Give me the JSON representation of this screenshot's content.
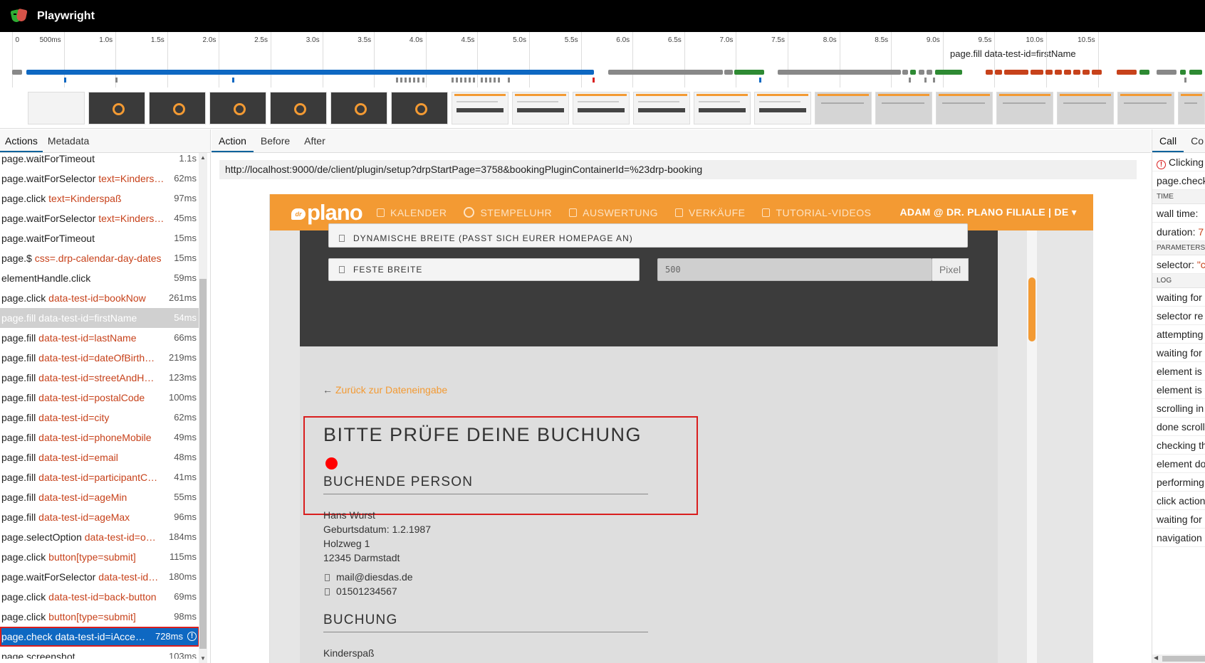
{
  "app": {
    "title": "Playwright"
  },
  "timeline": {
    "ticks": [
      "0",
      "500ms",
      "1.0s",
      "1.5s",
      "2.0s",
      "2.5s",
      "3.0s",
      "3.5s",
      "4.0s",
      "4.5s",
      "5.0s",
      "5.5s",
      "6.0s",
      "6.5s",
      "7.0s",
      "7.5s",
      "8.0s",
      "8.5s",
      "9.0s",
      "9.5s",
      "10.0s",
      "10.5s"
    ],
    "hover_label": "page.fill data-test-id=firstName"
  },
  "left_panel": {
    "tabs": [
      {
        "label": "Actions",
        "active": true
      },
      {
        "label": "Metadata",
        "active": false
      }
    ],
    "actions": [
      {
        "method": "page.waitForTimeout",
        "selector": "",
        "duration": "1.1s",
        "state": ""
      },
      {
        "method": "page.waitForSelector",
        "selector": "text=Kinders…",
        "duration": "62ms",
        "state": ""
      },
      {
        "method": "page.click",
        "selector": "text=Kinderspaß",
        "duration": "97ms",
        "state": ""
      },
      {
        "method": "page.waitForSelector",
        "selector": "text=Kinders…",
        "duration": "45ms",
        "state": ""
      },
      {
        "method": "page.waitForTimeout",
        "selector": "",
        "duration": "15ms",
        "state": ""
      },
      {
        "method": "page.$",
        "selector": "css=.drp-calendar-day-dates",
        "duration": "15ms",
        "state": ""
      },
      {
        "method": "elementHandle.click",
        "selector": "",
        "duration": "59ms",
        "state": ""
      },
      {
        "method": "page.click",
        "selector": "data-test-id=bookNow",
        "duration": "261ms",
        "state": ""
      },
      {
        "method": "page.fill",
        "selector": "data-test-id=firstName",
        "duration": "54ms",
        "state": "selected"
      },
      {
        "method": "page.fill",
        "selector": "data-test-id=lastName",
        "duration": "66ms",
        "state": ""
      },
      {
        "method": "page.fill",
        "selector": "data-test-id=dateOfBirth…",
        "duration": "219ms",
        "state": ""
      },
      {
        "method": "page.fill",
        "selector": "data-test-id=streetAndH…",
        "duration": "123ms",
        "state": ""
      },
      {
        "method": "page.fill",
        "selector": "data-test-id=postalCode",
        "duration": "100ms",
        "state": ""
      },
      {
        "method": "page.fill",
        "selector": "data-test-id=city",
        "duration": "62ms",
        "state": ""
      },
      {
        "method": "page.fill",
        "selector": "data-test-id=phoneMobile",
        "duration": "49ms",
        "state": ""
      },
      {
        "method": "page.fill",
        "selector": "data-test-id=email",
        "duration": "48ms",
        "state": ""
      },
      {
        "method": "page.fill",
        "selector": "data-test-id=participantC…",
        "duration": "41ms",
        "state": ""
      },
      {
        "method": "page.fill",
        "selector": "data-test-id=ageMin",
        "duration": "55ms",
        "state": ""
      },
      {
        "method": "page.fill",
        "selector": "data-test-id=ageMax",
        "duration": "96ms",
        "state": ""
      },
      {
        "method": "page.selectOption",
        "selector": "data-test-id=o…",
        "duration": "184ms",
        "state": ""
      },
      {
        "method": "page.click",
        "selector": "button[type=submit]",
        "duration": "115ms",
        "state": ""
      },
      {
        "method": "page.waitForSelector",
        "selector": "data-test-id…",
        "duration": "180ms",
        "state": ""
      },
      {
        "method": "page.click",
        "selector": "data-test-id=back-button",
        "duration": "69ms",
        "state": ""
      },
      {
        "method": "page.click",
        "selector": "button[type=submit]",
        "duration": "98ms",
        "state": ""
      },
      {
        "method": "page.check",
        "selector": "data-test-id=iAcce…",
        "duration": "728ms",
        "state": "active"
      },
      {
        "method": "page.screenshot",
        "selector": "",
        "duration": "103ms",
        "state": ""
      }
    ]
  },
  "middle_panel": {
    "tabs": [
      {
        "label": "Action",
        "active": true
      },
      {
        "label": "Before",
        "active": false
      },
      {
        "label": "After",
        "active": false
      }
    ],
    "url": "http://localhost:9000/de/client/plugin/setup?drpStartPage=3758&bookingPluginContainerId=%23drp-booking"
  },
  "snapshot": {
    "brand": {
      "prefix": "dr",
      "name": "plano"
    },
    "nav": [
      "KALENDER",
      "STEMPELUHR",
      "AUSWERTUNG",
      "VERKÄUFE",
      "TUTORIAL-VIDEOS"
    ],
    "user": "ADAM @ DR. PLANO FILIALE | DE ▾",
    "option_dynamic": "DYNAMISCHE BREITE (PASST SICH EURER HOMEPAGE AN)",
    "option_fixed": "FESTE BREITE",
    "width_value": "500",
    "width_unit": "Pixel",
    "back_link": "Zurück zur Dateneingabe",
    "heading": "BITTE PRÜFE DEINE BUCHUNG",
    "section_person": "BUCHENDE PERSON",
    "person": {
      "name": "Hans Wurst",
      "birth": "Geburtsdatum: 1.2.1987",
      "street": "Holzweg 1",
      "city": "12345 Darmstadt",
      "email": "mail@diesdas.de",
      "phone": "01501234567"
    },
    "section_booking": "BUCHUNG",
    "booking_item": "Kinderspaß",
    "colors": {
      "accent": "#f39a33",
      "highlight": "#d91e1e"
    }
  },
  "right_panel": {
    "tabs": [
      {
        "label": "Call",
        "active": true
      },
      {
        "label": "Co",
        "active": false
      }
    ],
    "error_text": "Clicking",
    "call_text": "page.check",
    "time_header": "TIME",
    "wall_time_label": "wall time:",
    "wall_time_value": "",
    "duration_label": "duration:",
    "duration_value": "7",
    "params_header": "PARAMETERS",
    "selector_label": "selector:",
    "selector_value": "\"c",
    "log_header": "LOG",
    "log": [
      "waiting for",
      "selector re",
      "attempting",
      "waiting for",
      "element is",
      "element is",
      "scrolling in",
      "done scroll",
      "checking th",
      "element do",
      "performing",
      "click action",
      "waiting for",
      "navigation"
    ]
  }
}
